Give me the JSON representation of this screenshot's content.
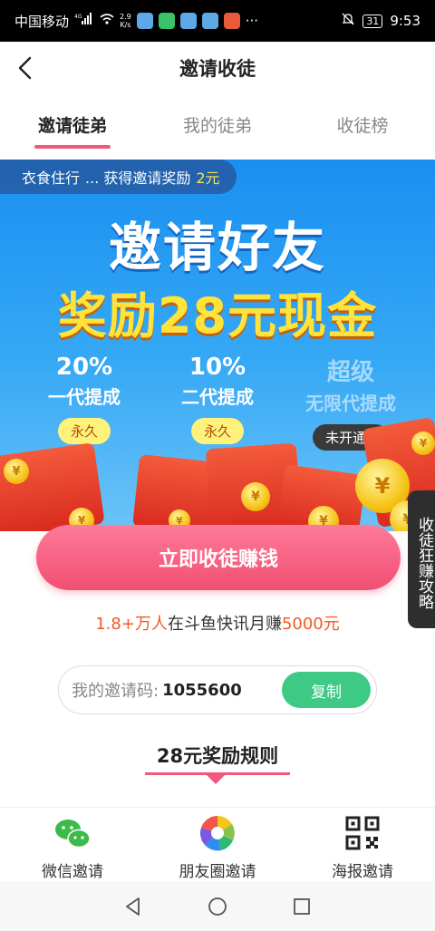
{
  "status_bar": {
    "carrier": "中国移动",
    "network_badge": "4G",
    "speed": "2.9",
    "speed_unit": "K/s",
    "more": "···",
    "battery": "31",
    "time": "9:53"
  },
  "header": {
    "title": "邀请收徒"
  },
  "tabs": [
    {
      "label": "邀请徒弟",
      "active": true
    },
    {
      "label": "我的徒弟",
      "active": false
    },
    {
      "label": "收徒榜",
      "active": false
    }
  ],
  "banner": {
    "ticker_user": "衣食住行",
    "ticker_text": "... 获得邀请奖励",
    "ticker_amount": "2元",
    "headline_1": "邀请好友",
    "headline_2": "奖励28元现金",
    "commissions": [
      {
        "pct": "20%",
        "label": "一代提成",
        "badge": "永久"
      },
      {
        "pct": "10%",
        "label": "二代提成",
        "badge": "永久"
      },
      {
        "pct": "超级",
        "label": "无限代提成",
        "badge": "未开通 ›"
      }
    ]
  },
  "cta": {
    "label": "立即收徒赚钱"
  },
  "stat": {
    "count": "1.8+万人",
    "mid": "在斗鱼快讯月赚",
    "amount": "5000元"
  },
  "invite": {
    "label": "我的邀请码:",
    "code": "1055600",
    "copy_label": "复制"
  },
  "rules": {
    "title": "28元奖励规则"
  },
  "side_tab": {
    "label": "收徒狂赚攻略"
  },
  "share": [
    {
      "label": "微信邀请",
      "icon": "wechat-icon"
    },
    {
      "label": "朋友圈邀请",
      "icon": "moments-icon"
    },
    {
      "label": "海报邀请",
      "icon": "qrcode-icon"
    }
  ],
  "colors": {
    "accent": "#f3577b",
    "green": "#3ec985",
    "banner_blue": "#1a8ff0",
    "gold": "#ffe33b"
  }
}
